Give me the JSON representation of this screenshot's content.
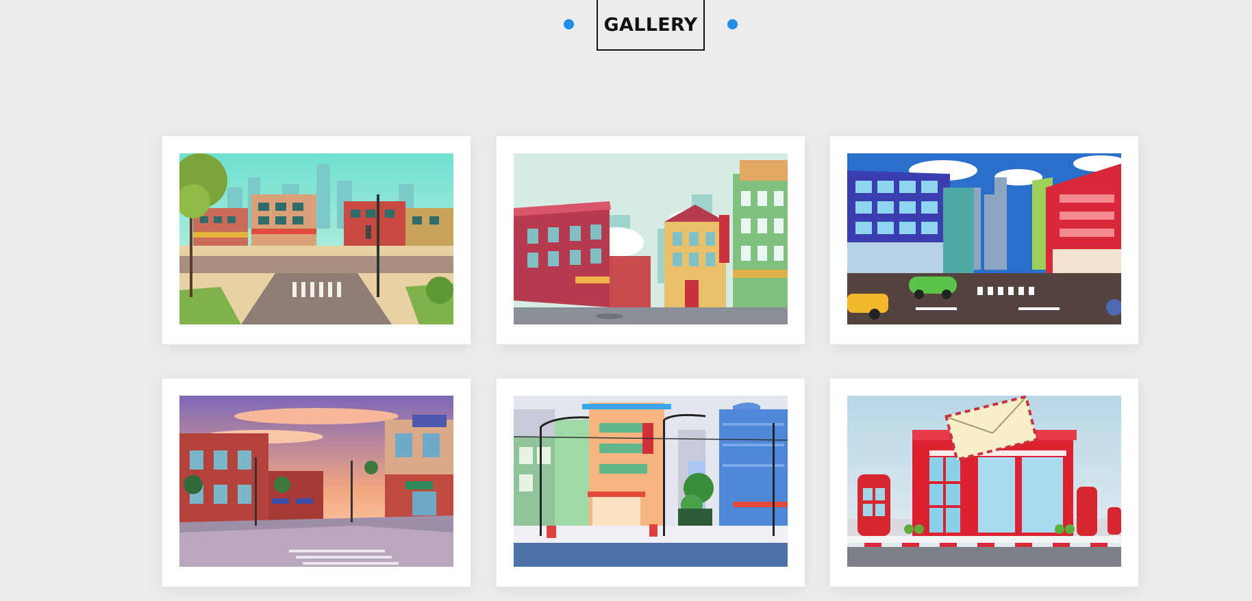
{
  "header": {
    "title": "GALLERY"
  },
  "colors": {
    "accent": "#1e8ee8",
    "background": "#ececec",
    "card": "#ffffff"
  },
  "gallery": {
    "items": [
      {
        "image": "city-crossroad-illustration-icon"
      },
      {
        "image": "street-buildings-hotel-illustration-icon"
      },
      {
        "image": "downtown-traffic-illustration-icon"
      },
      {
        "image": "sunset-street-corner-illustration-icon"
      },
      {
        "image": "city-street-lamps-illustration-icon"
      },
      {
        "image": "post-office-illustration-icon"
      }
    ]
  }
}
